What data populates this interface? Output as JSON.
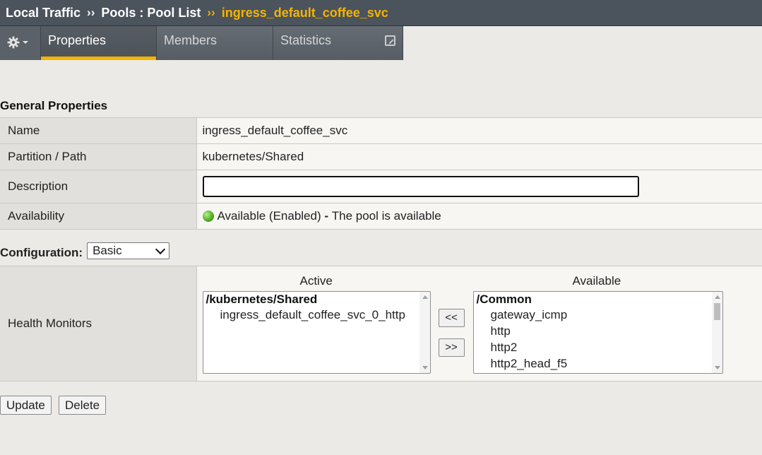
{
  "breadcrumb": {
    "items": [
      "Local Traffic",
      "Pools : Pool List"
    ],
    "separator": "››",
    "current": "ingress_default_coffee_svc"
  },
  "tabs": {
    "gear_menu": "gear-icon",
    "items": [
      {
        "label": "Properties",
        "active": true
      },
      {
        "label": "Members",
        "active": false
      },
      {
        "label": "Statistics",
        "active": false
      }
    ]
  },
  "general": {
    "title": "General Properties",
    "rows": {
      "name": {
        "label": "Name",
        "value": "ingress_default_coffee_svc"
      },
      "partition": {
        "label": "Partition / Path",
        "value": "kubernetes/Shared"
      },
      "description": {
        "label": "Description",
        "value": ""
      },
      "availability": {
        "label": "Availability",
        "status": "Available (Enabled)",
        "dash": " - ",
        "message": "The pool is available",
        "status_color": "#4caa1f"
      }
    }
  },
  "configuration": {
    "label": "Configuration:",
    "selected": "Basic"
  },
  "health_monitors": {
    "label": "Health Monitors",
    "active_title": "Active",
    "available_title": "Available",
    "active_group": "/kubernetes/Shared",
    "active_items": [
      "ingress_default_coffee_svc_0_http"
    ],
    "available_group": "/Common",
    "available_items": [
      "gateway_icmp",
      "http",
      "http2",
      "http2_head_f5"
    ],
    "move_left": "<<",
    "move_right": ">>"
  },
  "actions": {
    "update": "Update",
    "delete": "Delete"
  },
  "colors": {
    "accent": "#f4b400",
    "header_bg": "#4b535c"
  }
}
